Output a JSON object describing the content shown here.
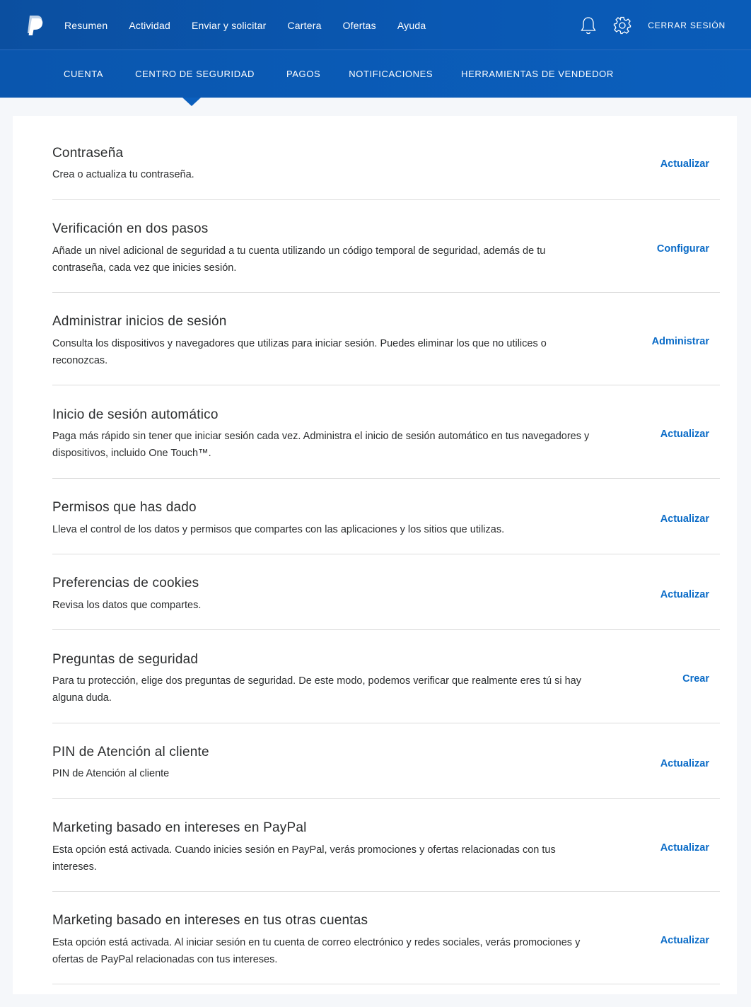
{
  "header": {
    "logo": "paypal-logo",
    "nav": [
      "Resumen",
      "Actividad",
      "Enviar y solicitar",
      "Cartera",
      "Ofertas",
      "Ayuda"
    ],
    "notifications_icon": "bell-icon",
    "settings_icon": "gear-icon",
    "logout_label": "CERRAR SESIÓN"
  },
  "subnav": {
    "tabs": [
      "CUENTA",
      "CENTRO DE SEGURIDAD",
      "PAGOS",
      "NOTIFICACIONES",
      "HERRAMIENTAS DE VENDEDOR"
    ],
    "active": "CENTRO DE SEGURIDAD"
  },
  "security": {
    "items": [
      {
        "title": "Contraseña",
        "desc": "Crea o actualiza tu contraseña.",
        "action": "Actualizar"
      },
      {
        "title": "Verificación en dos pasos",
        "desc": "Añade un nivel adicional de seguridad a tu cuenta utilizando un código temporal de seguridad, además de tu contraseña, cada vez que inicies sesión.",
        "action": "Configurar"
      },
      {
        "title": "Administrar inicios de sesión",
        "desc": "Consulta los dispositivos y navegadores que utilizas para iniciar sesión. Puedes eliminar los que no utilices o reconozcas.",
        "action": "Administrar"
      },
      {
        "title": "Inicio de sesión automático",
        "desc": "Paga más rápido sin tener que iniciar sesión cada vez. Administra el inicio de sesión automático en tus navegadores y dispositivos, incluido One Touch™.",
        "action": "Actualizar"
      },
      {
        "title": "Permisos que has dado",
        "desc": "Lleva el control de los datos y permisos que compartes con las aplicaciones y los sitios que utilizas.",
        "action": "Actualizar"
      },
      {
        "title": "Preferencias de cookies",
        "desc": "Revisa los datos que compartes.",
        "action": "Actualizar"
      },
      {
        "title": "Preguntas de seguridad",
        "desc": "Para tu protección, elige dos preguntas de seguridad. De este modo, podemos verificar que realmente eres tú si hay alguna duda.",
        "action": "Crear"
      },
      {
        "title": "PIN de Atención al cliente",
        "desc": "PIN de Atención al cliente",
        "action": "Actualizar"
      },
      {
        "title": "Marketing basado en intereses en PayPal",
        "desc": "Esta opción está activada. Cuando inicies sesión en PayPal, verás promociones y ofertas relacionadas con tus intereses.",
        "action": "Actualizar"
      },
      {
        "title": "Marketing basado en intereses en tus otras cuentas",
        "desc": "Esta opción está activada. Al iniciar sesión en tu cuenta de correo electrónico y redes sociales, verás promociones y ofertas de PayPal relacionadas con tus intereses.",
        "action": "Actualizar"
      }
    ]
  }
}
